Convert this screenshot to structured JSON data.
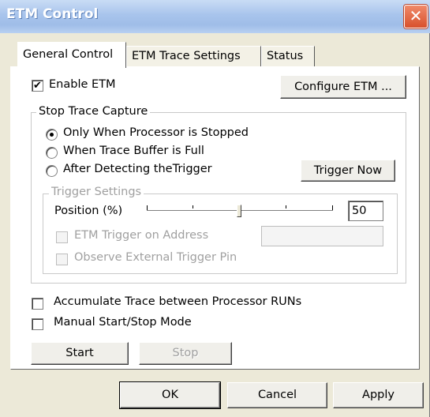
{
  "window": {
    "title": "ETM Control",
    "close_glyph": "✕"
  },
  "tabs": [
    {
      "label": "General Control",
      "active": true
    },
    {
      "label": "ETM Trace Settings",
      "active": false
    },
    {
      "label": "Status",
      "active": false
    }
  ],
  "general": {
    "enable_etm": {
      "label": "Enable ETM",
      "checked": true,
      "mark": "✔"
    },
    "configure_button": "Configure ETM ..."
  },
  "stop_trace": {
    "legend": "Stop Trace Capture",
    "options": [
      {
        "label": "Only When Processor is Stopped",
        "selected": true
      },
      {
        "label": "When Trace Buffer is Full",
        "selected": false
      },
      {
        "label": "After Detecting theTrigger",
        "selected": false
      }
    ],
    "trigger_now_button": "Trigger Now"
  },
  "trigger_settings": {
    "legend": "Trigger Settings",
    "position_label": "Position (%)",
    "position_value": "50",
    "slider_level_percent": 50,
    "etm_trigger_on_address": {
      "label": "ETM Trigger on Address",
      "checked": false,
      "value": ""
    },
    "observe_external": {
      "label": "Observe External Trigger Pin",
      "checked": false
    }
  },
  "options": {
    "accumulate": {
      "label": "Accumulate Trace between Processor RUNs",
      "checked": false
    },
    "manual_mode": {
      "label": "Manual Start/Stop Mode",
      "checked": false
    }
  },
  "controls": {
    "start": "Start",
    "stop": "Stop"
  },
  "footer": {
    "ok": "OK",
    "cancel": "Cancel",
    "apply": "Apply"
  }
}
